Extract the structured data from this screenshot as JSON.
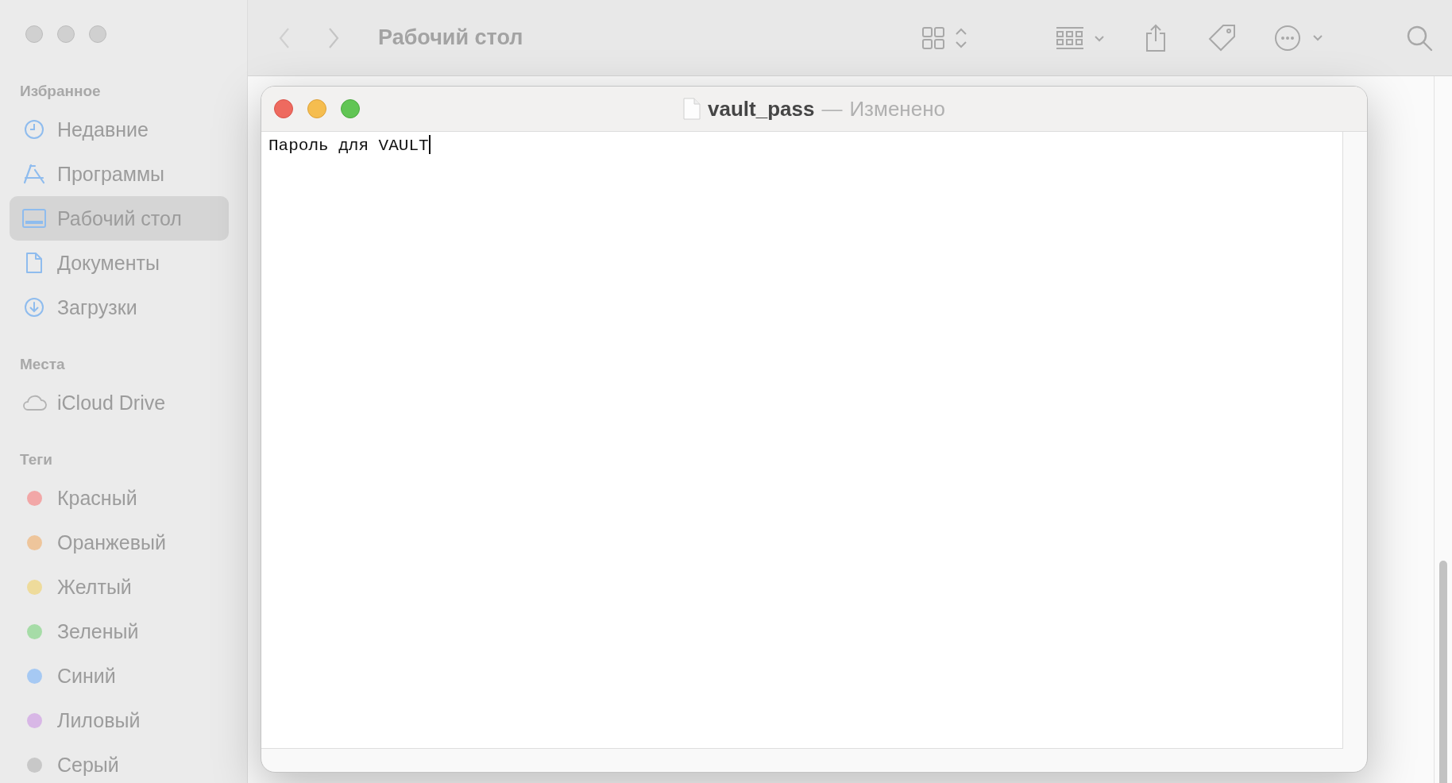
{
  "finder": {
    "toolbar": {
      "title": "Рабочий стол"
    },
    "sidebar": {
      "sections": [
        {
          "heading": "Избранное",
          "items": [
            {
              "label": "Недавние",
              "kind": "clock",
              "selected": false
            },
            {
              "label": "Программы",
              "kind": "apps",
              "selected": false
            },
            {
              "label": "Рабочий стол",
              "kind": "desktop",
              "selected": true
            },
            {
              "label": "Документы",
              "kind": "document",
              "selected": false
            },
            {
              "label": "Загрузки",
              "kind": "download",
              "selected": false
            }
          ]
        },
        {
          "heading": "Места",
          "items": [
            {
              "label": "iCloud Drive",
              "kind": "cloud",
              "selected": false
            }
          ]
        },
        {
          "heading": "Теги",
          "items": [
            {
              "label": "Красный",
              "kind": "tag",
              "color": "#f2a7a7",
              "selected": false
            },
            {
              "label": "Оранжевый",
              "kind": "tag",
              "color": "#eec59b",
              "selected": false
            },
            {
              "label": "Желтый",
              "kind": "tag",
              "color": "#eedb9b",
              "selected": false
            },
            {
              "label": "Зеленый",
              "kind": "tag",
              "color": "#a6dca7",
              "selected": false
            },
            {
              "label": "Синий",
              "kind": "tag",
              "color": "#a6c9f3",
              "selected": false
            },
            {
              "label": "Лиловый",
              "kind": "tag",
              "color": "#d8b7e6",
              "selected": false
            },
            {
              "label": "Серый",
              "kind": "tag",
              "color": "#c8c8c8",
              "selected": false
            }
          ]
        }
      ]
    }
  },
  "editor": {
    "title": "vault_pass",
    "separator": "—",
    "status": "Изменено",
    "text": "Пароль для VAULT"
  }
}
